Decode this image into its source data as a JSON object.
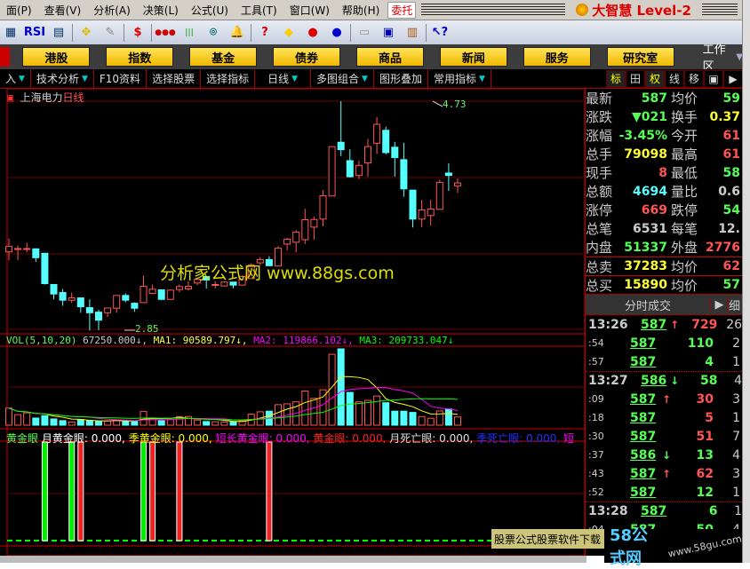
{
  "menu": {
    "items": [
      "面(P)",
      "查看(V)",
      "分析(A)",
      "决策(L)",
      "公式(U)",
      "工具(T)",
      "窗口(W)",
      "帮助(H)"
    ],
    "trade": "委托",
    "logo": "大智慧 Level-2"
  },
  "toolbar": {
    "icons": [
      "chart-icon",
      "rsi-icon",
      "grid-chart-icon",
      "cross-arrows-icon",
      "ruler-icon",
      "dollar-icon",
      "traffic-light-icon",
      "bars-icon",
      "binoculars-icon",
      "bell-icon",
      "question-chart-icon",
      "diamond-icon",
      "red-stock-icon",
      "blue-stock-icon",
      "clipboard-icon",
      "window-icon",
      "books-icon",
      "help-pointer-icon"
    ],
    "rsi": "RSI",
    "dollar": "$"
  },
  "nav": {
    "buttons": [
      "港股",
      "指数",
      "基金",
      "债券",
      "商品",
      "新闻",
      "服务",
      "研究室"
    ],
    "workarea": "工作区"
  },
  "tabs": {
    "items": [
      "入",
      "技术分析",
      "F10资料",
      "选择股票",
      "选择指标",
      "日线",
      "多图组合",
      "图形叠加",
      "常用指标"
    ],
    "right": [
      "标",
      "田",
      "权",
      "线",
      "移",
      "▣",
      "▶"
    ]
  },
  "chart": {
    "stock": "上海电力",
    "period": "日线",
    "high_label": "4.73",
    "low_label": "2.85",
    "watermark": "分析家公式网 www.88gs.com",
    "vol_title": "VOL(5,10,20)",
    "vol_value": "67250.000↓,",
    "ma1": "MA1: 90589.797↓,",
    "ma2": "MA2: 119866.102↓,",
    "ma3": "MA3: 209733.047↓",
    "ind_title": "黄金眼",
    "ind_items": [
      {
        "t": "月黄金眼: 0.000,",
        "c": "#ffffff"
      },
      {
        "t": "季黄金眼: 0.000,",
        "c": "#ffff00"
      },
      {
        "t": "短长黄金眼: 0.000,",
        "c": "#ff00ff"
      },
      {
        "t": "黄金眼: 0.000,",
        "c": "#ff2020"
      },
      {
        "t": "月死亡眼: 0.000,",
        "c": "#dddddd"
      },
      {
        "t": "季死亡眼: 0.000,",
        "c": "#2030ff"
      },
      {
        "t": "短",
        "c": "#ff00ff"
      }
    ]
  },
  "chart_data": {
    "type": "candlestick",
    "price_range": [
      2.85,
      4.73
    ],
    "ohlc": [
      [
        3.493,
        3.603,
        3.425,
        3.537
      ],
      [
        3.52,
        3.545,
        3.425,
        3.52
      ],
      [
        3.52,
        3.567,
        3.49,
        3.52
      ],
      [
        3.518,
        3.52,
        3.41,
        3.445
      ],
      [
        3.481,
        3.481,
        3.225,
        3.232
      ],
      [
        3.225,
        3.225,
        3.103,
        3.147
      ],
      [
        3.159,
        3.188,
        3.05,
        3.096
      ],
      [
        3.096,
        3.159,
        3.074,
        3.115
      ],
      [
        3.115,
        3.115,
        2.993,
        3.042
      ],
      [
        3.035,
        3.103,
        2.847,
        2.993
      ],
      [
        2.998,
        3.018,
        2.85,
        2.932
      ],
      [
        2.993,
        3.032,
        2.957,
        3.032
      ],
      [
        3.03,
        3.135,
        2.993,
        3.135
      ],
      [
        3.135,
        3.152,
        3.079,
        3.096
      ],
      [
        3.071,
        3.079,
        3.0,
        3.03
      ],
      [
        3.076,
        3.298,
        3.076,
        3.21
      ],
      [
        3.152,
        3.225,
        3.147,
        3.186
      ],
      [
        3.181,
        3.181,
        3.096,
        3.103
      ],
      [
        3.103,
        3.179,
        3.103,
        3.179
      ],
      [
        3.184,
        3.225,
        3.162,
        3.208
      ],
      [
        3.188,
        3.25,
        3.176,
        3.21
      ],
      [
        3.237,
        3.28,
        3.22,
        3.267
      ],
      [
        3.291,
        3.291,
        3.191,
        3.262
      ],
      [
        3.225,
        3.25,
        3.193,
        3.225
      ],
      [
        3.213,
        3.25,
        3.21,
        3.245
      ],
      [
        3.245,
        3.245,
        3.193,
        3.22
      ],
      [
        3.22,
        3.3,
        3.22,
        3.291
      ],
      [
        3.274,
        3.4,
        3.274,
        3.385
      ],
      [
        3.403,
        3.45,
        3.385,
        3.43
      ],
      [
        3.43,
        3.457,
        3.379,
        3.379
      ],
      [
        3.376,
        3.54,
        3.376,
        3.523
      ],
      [
        3.557,
        3.608,
        3.506,
        3.596
      ],
      [
        3.572,
        3.671,
        3.489,
        3.654
      ],
      [
        3.593,
        3.847,
        3.557,
        3.757
      ],
      [
        3.696,
        3.781,
        3.591,
        3.759
      ],
      [
        3.762,
        3.998,
        3.703,
        3.954
      ],
      [
        3.952,
        4.357,
        3.95,
        4.357
      ],
      [
        4.393,
        4.73,
        4.279,
        4.332
      ],
      [
        4.242,
        4.335,
        4.103,
        4.11
      ],
      [
        4.12,
        4.242,
        4.091,
        4.203
      ],
      [
        4.223,
        4.42,
        4.11,
        4.357
      ],
      [
        4.385,
        4.6,
        4.296,
        4.54
      ],
      [
        4.491,
        4.52,
        4.293,
        4.308
      ],
      [
        4.352,
        4.396,
        4.11,
        4.267
      ],
      [
        4.25,
        4.389,
        3.945,
        4.01
      ],
      [
        4.0,
        4.0,
        3.693,
        3.762
      ],
      [
        3.762,
        3.92,
        3.696,
        3.837
      ],
      [
        3.791,
        3.92,
        3.708,
        3.845
      ],
      [
        3.842,
        4.086,
        3.842,
        4.064
      ],
      [
        4.14,
        4.22,
        3.994,
        4.12
      ],
      [
        4.035,
        4.096,
        3.976,
        4.059
      ]
    ],
    "volume": [
      139000,
      86000,
      100000,
      58000,
      77000,
      51000,
      37000,
      26000,
      46000,
      39000,
      30000,
      35000,
      39000,
      35000,
      30000,
      111000,
      53000,
      37000,
      49000,
      70000,
      70000,
      42000,
      30000,
      28000,
      26000,
      30000,
      35000,
      90000,
      109000,
      114000,
      167000,
      174000,
      190000,
      278000,
      218000,
      288000,
      577000,
      621000,
      267000,
      190000,
      202000,
      237000,
      183000,
      114000,
      114000,
      104000,
      70000,
      56000,
      116000,
      132000,
      67250
    ],
    "ma_periods": [
      5,
      10,
      20
    ],
    "signals": [
      {
        "i": 4,
        "type": "green"
      },
      {
        "i": 7,
        "type": "green"
      },
      {
        "i": 8,
        "type": "red"
      },
      {
        "i": 15,
        "type": "green"
      },
      {
        "i": 16,
        "type": "red"
      },
      {
        "i": 19,
        "type": "red"
      },
      {
        "i": 29,
        "type": "red"
      }
    ]
  },
  "quote": {
    "rows": [
      {
        "l": "最新",
        "v": "587",
        "vc": "g",
        "l2": "均价",
        "v2": "59",
        "v2c": "g"
      },
      {
        "l": "涨跌",
        "v": "▼021",
        "vc": "g",
        "l2": "换手",
        "v2": "0.37",
        "v2c": "y"
      },
      {
        "l": "涨幅",
        "v": "-3.45%",
        "vc": "g",
        "l2": "今开",
        "v2": "61",
        "v2c": "r"
      },
      {
        "l": "总手",
        "v": "79098",
        "vc": "y",
        "l2": "最高",
        "v2": "61",
        "v2c": "r"
      },
      {
        "l": "现手",
        "v": "8",
        "vc": "r",
        "l2": "最低",
        "v2": "58",
        "v2c": "g"
      },
      {
        "l": "总额",
        "v": "4694",
        "vc": "c",
        "l2": "量比",
        "v2": "0.6",
        "v2c": "w"
      },
      {
        "l": "涨停",
        "v": "669",
        "vc": "r",
        "l2": "跌停",
        "v2": "54",
        "v2c": "g"
      },
      {
        "l": "总笔",
        "v": "6531",
        "vc": "w",
        "l2": "每笔",
        "v2": "12.",
        "v2c": "w"
      },
      {
        "l": "内盘",
        "v": "51337",
        "vc": "g",
        "l2": "外盘",
        "v2": "2776",
        "v2c": "r"
      }
    ],
    "sell": {
      "l": "总卖",
      "v": "37283",
      "l2": "均价",
      "v2": "62"
    },
    "buy": {
      "l": "总买",
      "v": "15890",
      "l2": "均价",
      "v2": "57"
    }
  },
  "trades": {
    "title": "分时成交",
    "detail": "细",
    "rows": [
      {
        "t": "13:26",
        "p": "587",
        "a": "↑",
        "v": "729",
        "vc": "r",
        "n": "26",
        "sep": false
      },
      {
        "t": ":54",
        "p": "587",
        "a": "",
        "v": "110",
        "vc": "g",
        "n": "2",
        "sep": false
      },
      {
        "t": ":57",
        "p": "587",
        "a": "",
        "v": "4",
        "vc": "g",
        "n": "1",
        "sep": false
      },
      {
        "t": "13:27",
        "p": "586",
        "a": "↓",
        "v": "58",
        "vc": "g",
        "n": "4",
        "sep": true
      },
      {
        "t": ":09",
        "p": "587",
        "a": "↑",
        "v": "30",
        "vc": "r",
        "n": "3",
        "sep": false
      },
      {
        "t": ":18",
        "p": "587",
        "a": "",
        "v": "5",
        "vc": "r",
        "n": "1",
        "sep": false
      },
      {
        "t": ":30",
        "p": "587",
        "a": "",
        "v": "51",
        "vc": "r",
        "n": "7",
        "sep": false
      },
      {
        "t": ":37",
        "p": "586",
        "a": "↓",
        "v": "13",
        "vc": "g",
        "n": "4",
        "sep": false
      },
      {
        "t": ":43",
        "p": "587",
        "a": "↑",
        "v": "62",
        "vc": "r",
        "n": "3",
        "sep": false
      },
      {
        "t": ":52",
        "p": "587",
        "a": "",
        "v": "12",
        "vc": "g",
        "n": "1",
        "sep": false
      },
      {
        "t": "13:28",
        "p": "587",
        "a": "",
        "v": "6",
        "vc": "g",
        "n": "1",
        "sep": true
      },
      {
        "t": ":04",
        "p": "587",
        "a": "",
        "v": "50",
        "vc": "g",
        "n": "4",
        "sep": false
      }
    ]
  },
  "ads": {
    "banner": "股票公式股票软件下载",
    "logo": "58公式网",
    "url": "www.58gu.com"
  },
  "colors": {
    "up": "#ff5555",
    "down": "#55ffff",
    "grid": "#6a0000",
    "ma1": "#ffff00",
    "ma2": "#ff00ff",
    "ma3": "#00ff00"
  }
}
